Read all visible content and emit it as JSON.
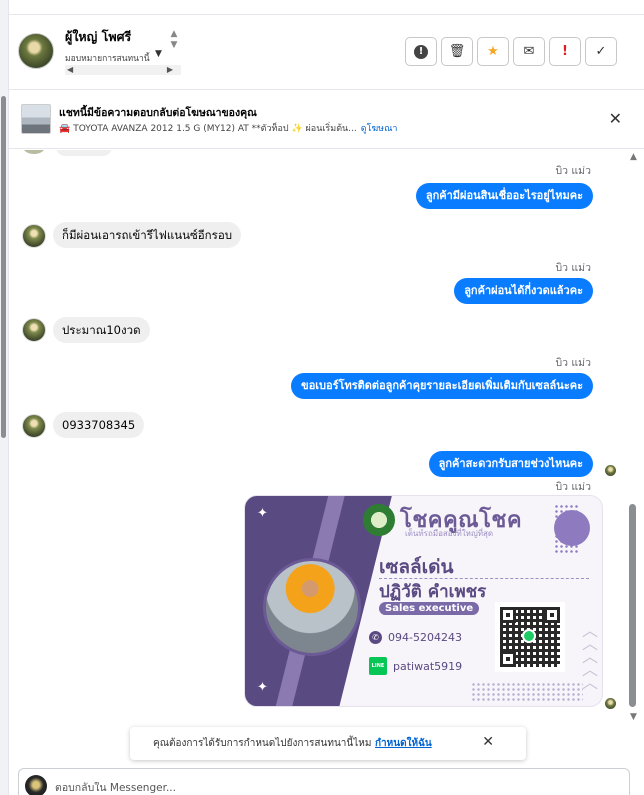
{
  "header": {
    "contact_name": "ผู้ใหญ่ โพศรี",
    "contact_sub": "มอบหมายการสนทนานี้"
  },
  "actions": [
    {
      "name": "info-button",
      "glyph": "!"
    },
    {
      "name": "delete-button",
      "glyph": "🗑"
    },
    {
      "name": "star-button",
      "glyph": "★"
    },
    {
      "name": "email-button",
      "glyph": "✉"
    },
    {
      "name": "spam-button",
      "glyph": "!"
    },
    {
      "name": "done-button",
      "glyph": "✓"
    }
  ],
  "ad_banner": {
    "title": "แชทนี้มีข้อความตอบกลับต่อโฆษณาของคุณ",
    "listing": "TOYOTA AVANZA 2012 1.5 G (MY12) AT **ตัวท็อป ✨ ผ่อนเริ่มต้น...",
    "link": "ดูโฆษณา"
  },
  "messages": {
    "sender_name": "บิว แม่ว",
    "out_1": "ลูกค้ามีผ่อนสินเชื่ออะไรอยู่ไหมคะ",
    "in_1": "ก็มีผ่อนเอารถเข้ารีไฟแนนซ์อีกรอบ",
    "out_2": "ลูกค้าผ่อนได้กี่งวดแล้วคะ",
    "in_2": "ประมาณ10งวด",
    "out_3": "ขอเบอร์โทรติดต่อลูกค้าคุยรายละเอียดเพิ่มเติมกับเซลล์นะคะ",
    "in_3": "0933708345",
    "out_4": "ลูกค้าสะดวกรับสายช่วงไหนคะ"
  },
  "card": {
    "brand": "โชคคูณโชค",
    "tagline": "เต็นท์รถมือสองที่ใหญ่ที่สุด",
    "sale_word": "เซลล์เด่น",
    "sale_name": "ปฏิวัติ คำเพชร",
    "role": "Sales executive",
    "phone": "094-5204243",
    "line_badge": "LINE",
    "line_id": "patiwat5919"
  },
  "notification": {
    "text": "คุณต้องการได้รับการกำหนดไปยังการสนทนานี้ไหม",
    "link": "กำหนดให้ฉัน"
  },
  "composer": {
    "placeholder": "ตอบกลับใน Messenger..."
  },
  "colors": {
    "outgoing_bubble": "#0a7cff",
    "incoming_bubble": "#efefef",
    "link": "#0064d1",
    "card_purple": "#5a4a82"
  }
}
